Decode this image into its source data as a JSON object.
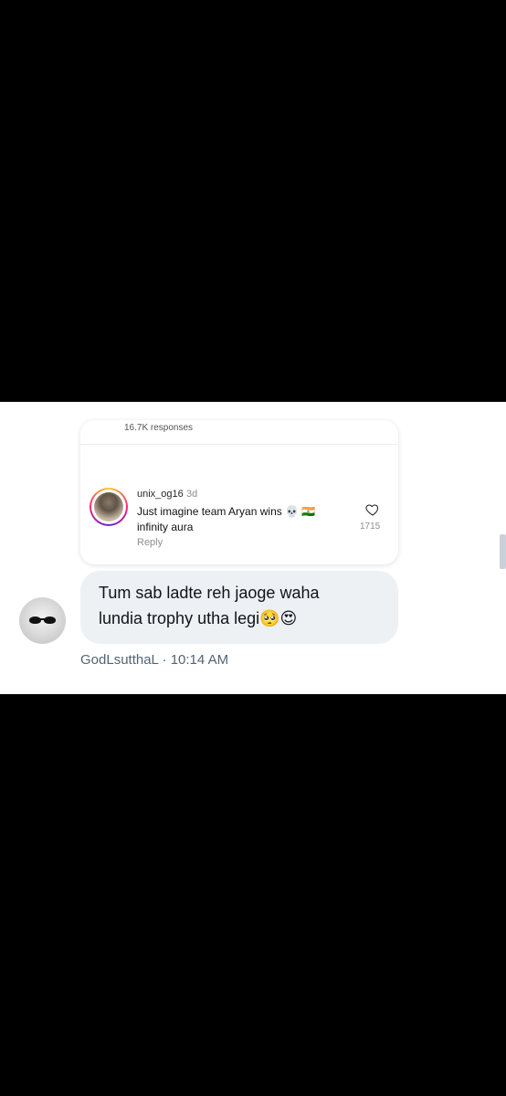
{
  "card": {
    "header_partial": "16.7K responses",
    "comment": {
      "username": "unix_og16",
      "time": "3d",
      "text_line1": "Just imagine team Aryan wins 💀 🇮🇳",
      "text_line2": "infinity aura",
      "reply_label": "Reply",
      "likes": "1715"
    }
  },
  "message": {
    "line1": "Tum sab ladte reh jaoge waha",
    "line2": "lundia trophy utha legi🥺😍",
    "sender": "GodLsutthaL",
    "separator": "·",
    "time": "10:14 AM"
  },
  "icons": {
    "like": "heart-outline-icon"
  },
  "colors": {
    "bubble": "#eef1f4",
    "meta_text": "#536471"
  }
}
